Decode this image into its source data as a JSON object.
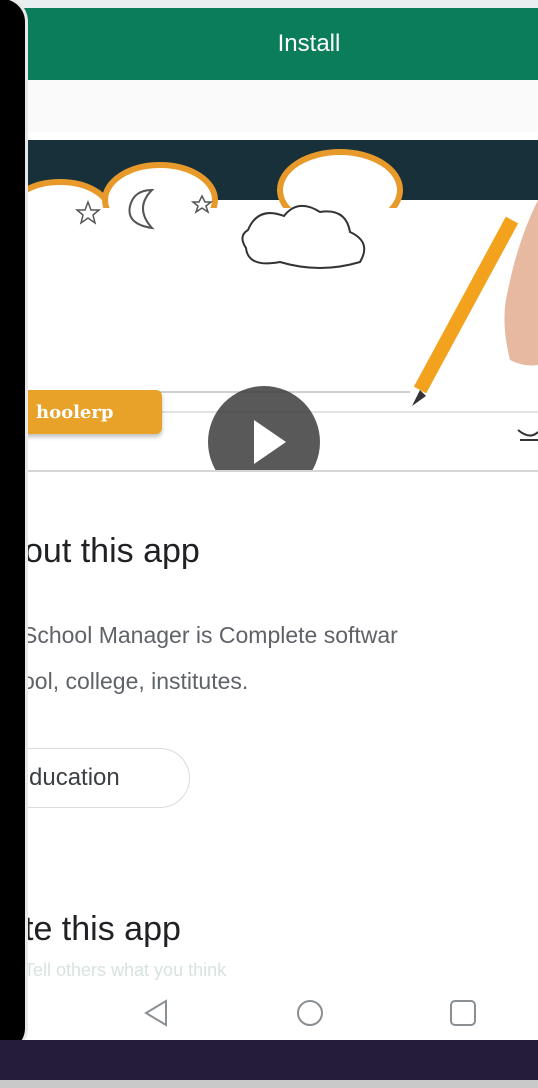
{
  "install_bar": {
    "label": "Install"
  },
  "video": {
    "badge_text": "hoolerp"
  },
  "about": {
    "heading": "out this app",
    "description_line1": "School Manager is Complete softwar",
    "description_line2": "ool, college, institutes.",
    "category_chip": "ducation"
  },
  "rate": {
    "heading": "te this app",
    "hint": "Tell others what you think"
  },
  "navigation": {
    "back_icon": "back-triangle-icon",
    "home_icon": "home-circle-icon",
    "recents_icon": "recents-square-icon"
  },
  "colors": {
    "install_bar": "#0c7d5b",
    "video_band": "#17303a",
    "badge": "#e8a22a"
  }
}
